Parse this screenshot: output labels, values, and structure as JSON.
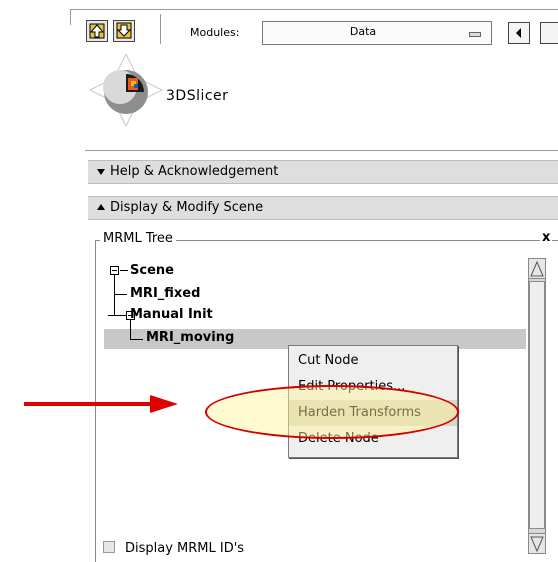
{
  "toolbar": {
    "modules_label": "Modules:",
    "module_selected": "Data",
    "icons": [
      "home-up-icon",
      "module-download-icon",
      "previous-module-icon",
      "next-module-icon"
    ]
  },
  "logo": {
    "text": "3DSlicer"
  },
  "panels": {
    "help": {
      "label": "Help & Acknowledgement",
      "expanded": false
    },
    "display": {
      "label": "Display & Modify Scene",
      "expanded": true
    }
  },
  "mrml_tree": {
    "title": "MRML Tree",
    "close_glyph": "x",
    "nodes": [
      {
        "label": "Scene",
        "level": 0,
        "expandable": true
      },
      {
        "label": "MRI_fixed",
        "level": 1,
        "expandable": false
      },
      {
        "label": "Manual Init",
        "level": 1,
        "expandable": true
      },
      {
        "label": "MRI_moving",
        "level": 2,
        "expandable": false,
        "selected": true
      }
    ]
  },
  "context_menu": {
    "items": [
      {
        "label": "Cut Node",
        "highlighted": false
      },
      {
        "label": "Edit Properties...",
        "highlighted": false
      },
      {
        "label": "Harden Transforms",
        "highlighted": true
      },
      {
        "label": "Delete Node",
        "highlighted": false
      }
    ]
  },
  "display_ids": {
    "label": "Display MRML ID's",
    "checked": false
  },
  "annotation": {
    "arrow_color": "#e00000",
    "ellipse_color": "#d20000",
    "ellipse_fill": "#fff59a"
  }
}
